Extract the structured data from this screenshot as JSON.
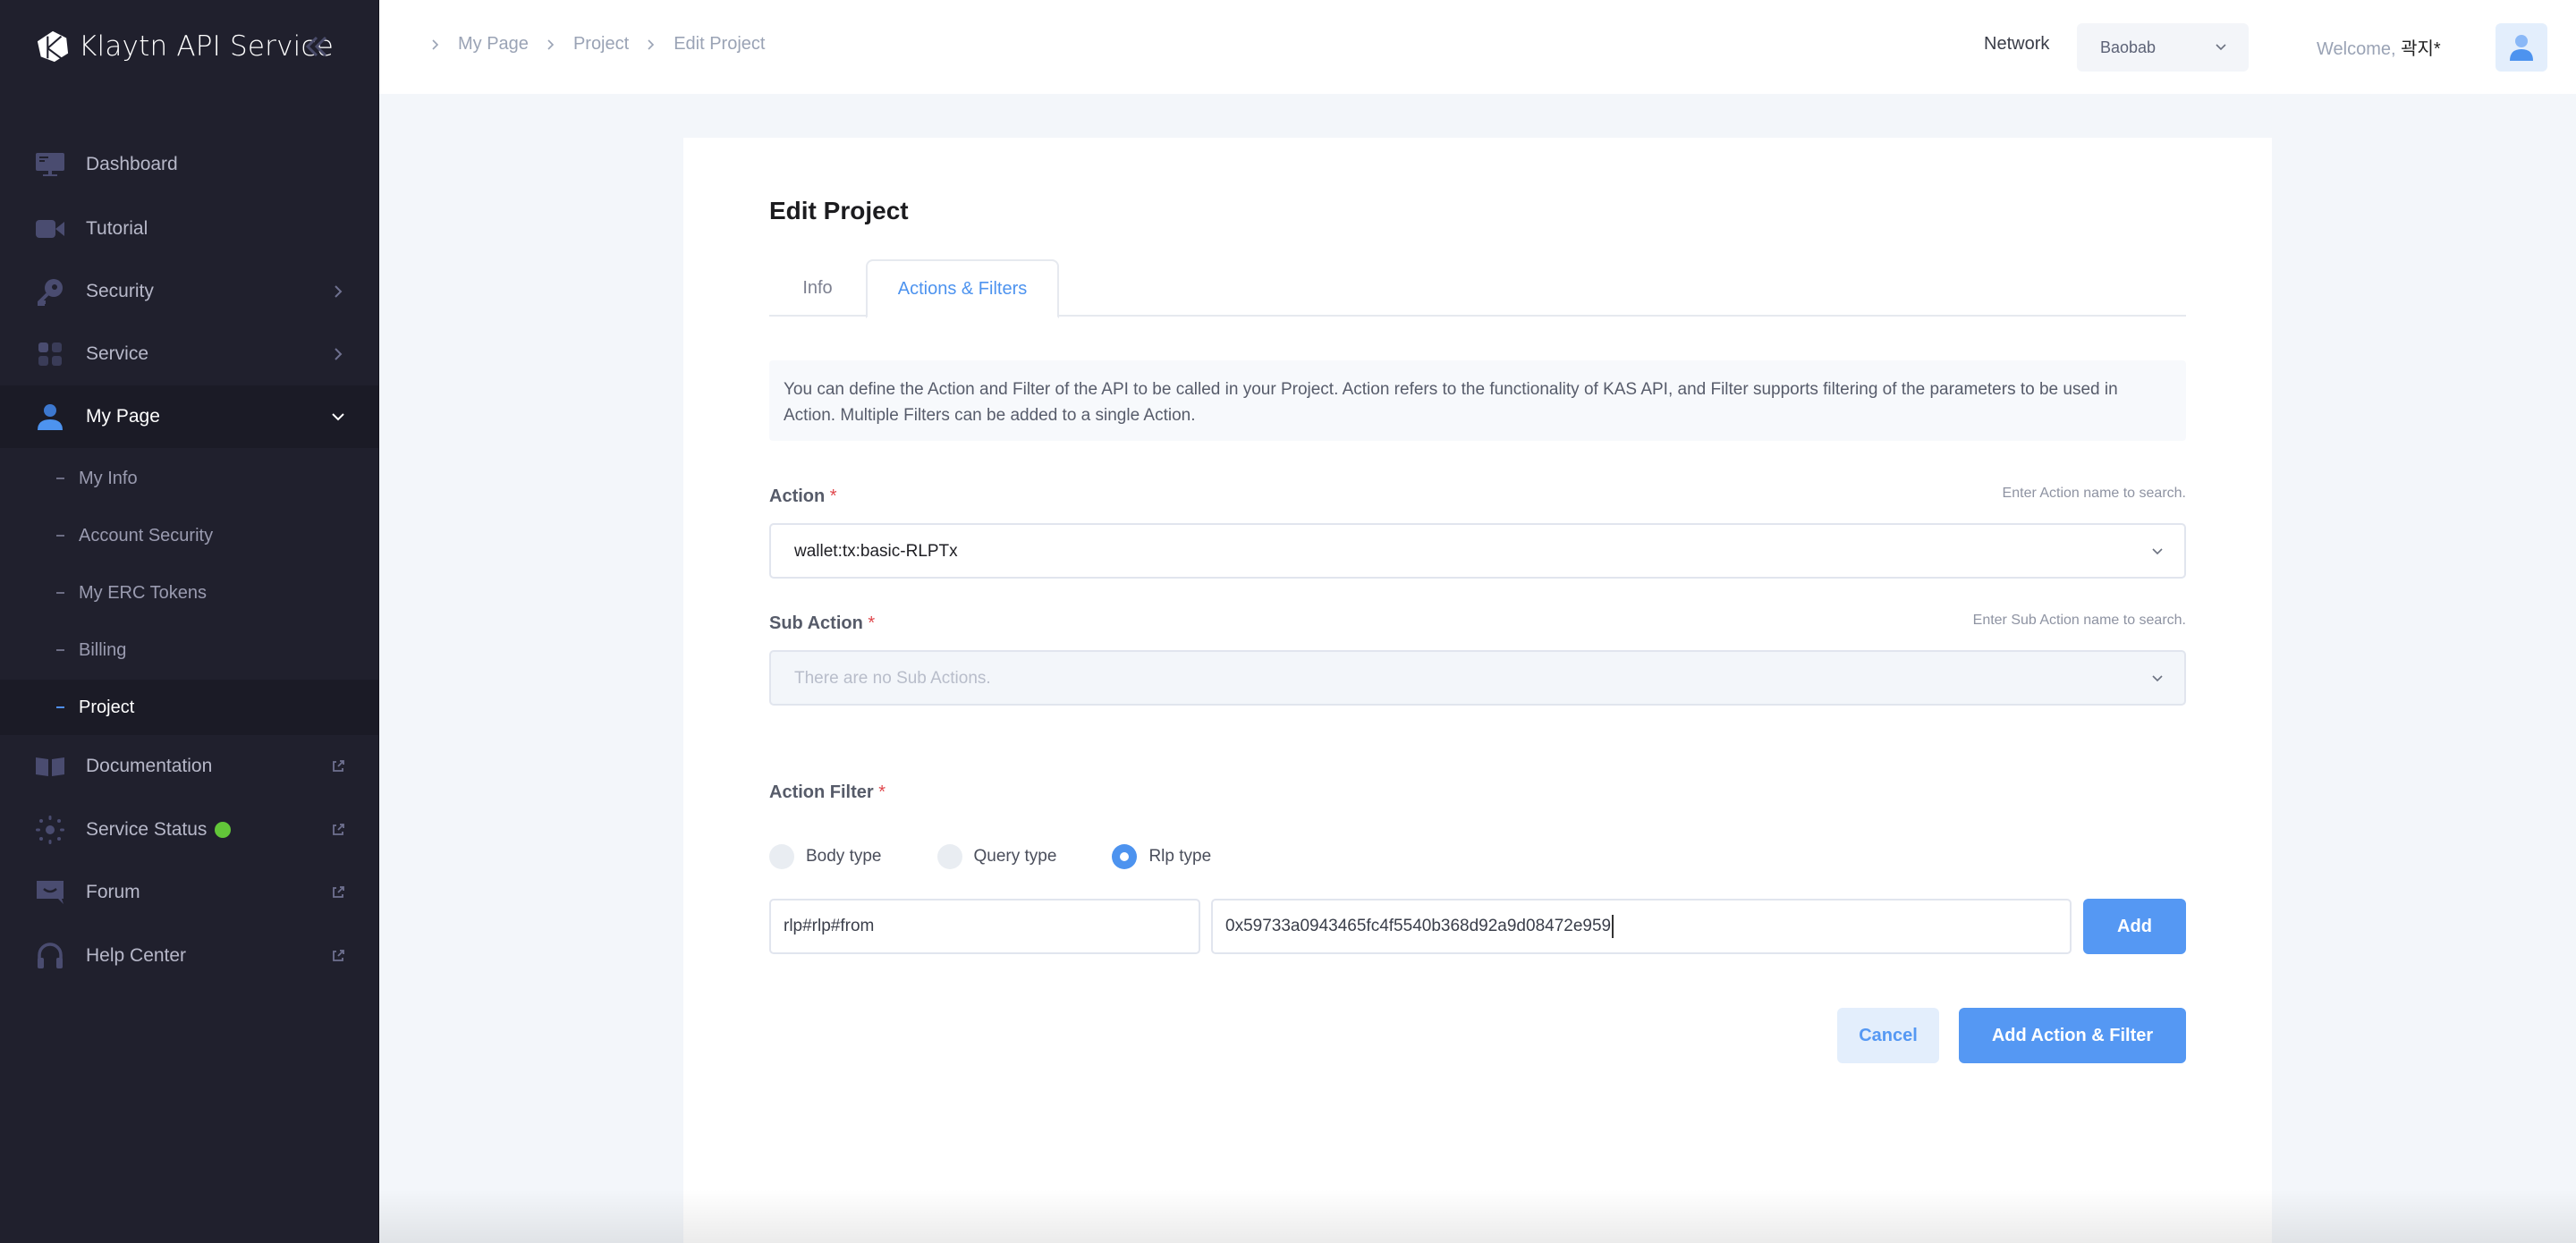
{
  "app": {
    "title": "Klaytn API Service"
  },
  "sidebar": {
    "items": [
      {
        "label": "Dashboard",
        "icon": "monitor-icon"
      },
      {
        "label": "Tutorial",
        "icon": "video-camera-icon"
      },
      {
        "label": "Security",
        "icon": "key-icon",
        "has_submenu": true
      },
      {
        "label": "Service",
        "icon": "grid-icon",
        "has_submenu": true
      },
      {
        "label": "My Page",
        "icon": "user-icon",
        "expanded": true
      }
    ],
    "sub_items": [
      {
        "label": "My Info"
      },
      {
        "label": "Account Security"
      },
      {
        "label": "My ERC Tokens"
      },
      {
        "label": "Billing"
      },
      {
        "label": "Project",
        "active": true
      }
    ],
    "external_items": [
      {
        "label": "Documentation",
        "icon": "book-icon"
      },
      {
        "label": "Service Status",
        "icon": "status-sun-icon",
        "status_color": "#62c639"
      },
      {
        "label": "Forum",
        "icon": "chat-icon"
      },
      {
        "label": "Help Center",
        "icon": "headphones-icon"
      }
    ]
  },
  "header": {
    "breadcrumb": [
      "My Page",
      "Project",
      "Edit Project"
    ],
    "network_label": "Network",
    "network_value": "Baobab",
    "welcome_prefix": "Welcome,",
    "username": "곽지*"
  },
  "main": {
    "title": "Edit Project",
    "tabs": [
      {
        "label": "Info",
        "active": false
      },
      {
        "label": "Actions & Filters",
        "active": true
      }
    ],
    "description": "You can define the Action and Filter of the API to be called in your Project. Action refers to the functionality of KAS API, and Filter supports filtering of the parameters to be used in Action. Multiple Filters can be added to a single Action.",
    "action": {
      "label": "Action",
      "required_mark": "*",
      "hint": "Enter Action name to search.",
      "value": "wallet:tx:basic-RLPTx"
    },
    "sub_action": {
      "label": "Sub Action",
      "required_mark": "*",
      "hint": "Enter Sub Action name to search.",
      "placeholder": "There are no Sub Actions."
    },
    "action_filter": {
      "label": "Action Filter",
      "required_mark": "*",
      "types": [
        {
          "label": "Body type",
          "checked": false
        },
        {
          "label": "Query type",
          "checked": false
        },
        {
          "label": "Rlp type",
          "checked": true
        }
      ],
      "key_value": "rlp#rlp#from",
      "value_value": "0x59733a0943465fc4f5540b368d92a9d08472e959",
      "add_label": "Add"
    },
    "cancel_label": "Cancel",
    "submit_label": "Add Action & Filter"
  },
  "colors": {
    "accent": "#5598f3",
    "sidebar_bg": "#20202d",
    "required": "#e0474c",
    "status_ok": "#62c639"
  }
}
